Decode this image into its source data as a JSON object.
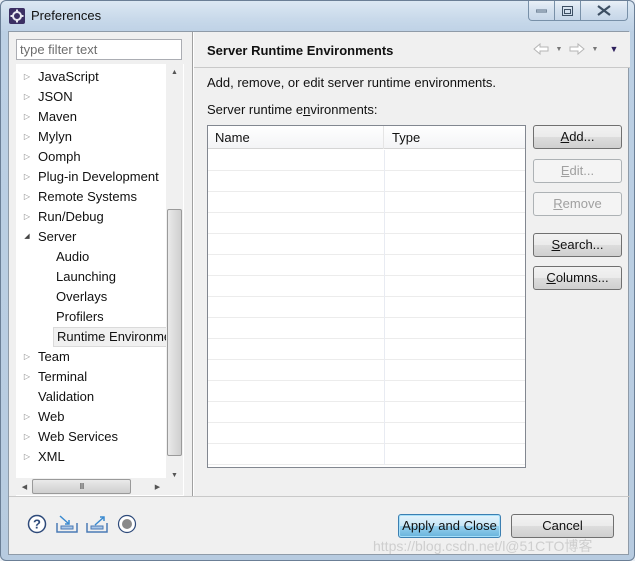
{
  "window": {
    "title": "Preferences",
    "icon": "eclipse-gear-icon",
    "controls": [
      "minimize",
      "maximize",
      "close"
    ]
  },
  "filter": {
    "placeholder": "type filter text",
    "value": ""
  },
  "tree": {
    "items": [
      {
        "label": "JavaScript",
        "level": 0,
        "expandable": true,
        "expanded": false
      },
      {
        "label": "JSON",
        "level": 0,
        "expandable": true,
        "expanded": false
      },
      {
        "label": "Maven",
        "level": 0,
        "expandable": true,
        "expanded": false
      },
      {
        "label": "Mylyn",
        "level": 0,
        "expandable": true,
        "expanded": false
      },
      {
        "label": "Oomph",
        "level": 0,
        "expandable": true,
        "expanded": false
      },
      {
        "label": "Plug-in Development",
        "level": 0,
        "expandable": true,
        "expanded": false
      },
      {
        "label": "Remote Systems",
        "level": 0,
        "expandable": true,
        "expanded": false
      },
      {
        "label": "Run/Debug",
        "level": 0,
        "expandable": true,
        "expanded": false
      },
      {
        "label": "Server",
        "level": 0,
        "expandable": true,
        "expanded": true
      },
      {
        "label": "Audio",
        "level": 1,
        "expandable": false
      },
      {
        "label": "Launching",
        "level": 1,
        "expandable": false
      },
      {
        "label": "Overlays",
        "level": 1,
        "expandable": false
      },
      {
        "label": "Profilers",
        "level": 1,
        "expandable": false
      },
      {
        "label": "Runtime Environme",
        "level": 1,
        "expandable": false,
        "selected": true
      },
      {
        "label": "Team",
        "level": 0,
        "expandable": true,
        "expanded": false
      },
      {
        "label": "Terminal",
        "level": 0,
        "expandable": true,
        "expanded": false
      },
      {
        "label": "Validation",
        "level": 0,
        "expandable": false
      },
      {
        "label": "Web",
        "level": 0,
        "expandable": true,
        "expanded": false
      },
      {
        "label": "Web Services",
        "level": 0,
        "expandable": true,
        "expanded": false
      },
      {
        "label": "XML",
        "level": 0,
        "expandable": true,
        "expanded": false
      }
    ],
    "hscroll_thumb_glyph": "III"
  },
  "page": {
    "title": "Server Runtime Environments",
    "description": "Add, remove, or edit server runtime environments.",
    "list_label_pre": "Server runtime e",
    "list_label_mnemonic": "n",
    "list_label_post": "vironments:",
    "table": {
      "columns": [
        "Name",
        "Type"
      ],
      "rows": []
    },
    "buttons": [
      {
        "id": "add",
        "mnemonic": "A",
        "rest": "dd...",
        "enabled": true
      },
      {
        "id": "edit",
        "mnemonic": "E",
        "rest": "dit...",
        "enabled": false
      },
      {
        "id": "remove",
        "mnemonic": "R",
        "rest": "emove",
        "enabled": false
      },
      {
        "id": "search",
        "mnemonic": "S",
        "rest": "earch...",
        "enabled": true
      },
      {
        "id": "columns",
        "mnemonic": "C",
        "rest": "olumns...",
        "enabled": true
      }
    ]
  },
  "footer": {
    "apply_close_label": "Apply and Close",
    "cancel_label": "Cancel",
    "icons": [
      "help-icon",
      "import-icon",
      "export-icon",
      "record-icon"
    ]
  },
  "watermark": "https://blog.csdn.net/l@51CTO博客"
}
